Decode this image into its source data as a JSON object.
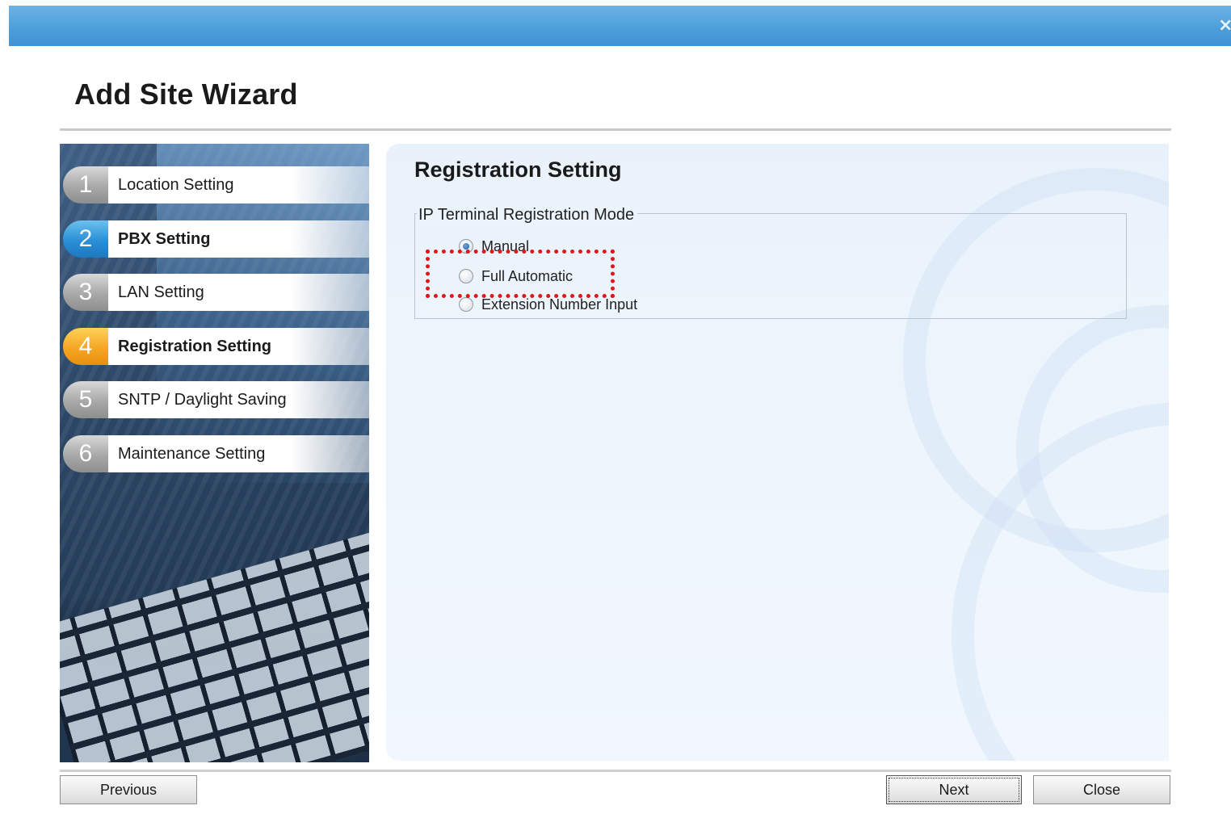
{
  "window": {
    "close_glyph": "×"
  },
  "wizard": {
    "title": "Add Site Wizard"
  },
  "steps": [
    {
      "number": "1",
      "label": "Location Setting",
      "state": "pending"
    },
    {
      "number": "2",
      "label": "PBX Setting",
      "state": "completed"
    },
    {
      "number": "3",
      "label": "LAN Setting",
      "state": "pending"
    },
    {
      "number": "4",
      "label": "Registration Setting",
      "state": "current"
    },
    {
      "number": "5",
      "label": "SNTP / Daylight Saving",
      "state": "pending"
    },
    {
      "number": "6",
      "label": "Maintenance Setting",
      "state": "pending"
    }
  ],
  "section": {
    "title": "Registration Setting",
    "group_label": "IP Terminal Registration Mode",
    "options": [
      {
        "label": "Manual",
        "selected": true
      },
      {
        "label": "Full Automatic",
        "selected": false,
        "highlighted": true
      },
      {
        "label": "Extension Number Input",
        "selected": false
      }
    ]
  },
  "buttons": {
    "previous": "Previous",
    "next": "Next",
    "close": "Close"
  },
  "colors": {
    "title_bar": "#4d9fdb",
    "step_completed": "#2a8fd6",
    "step_current": "#f5a623",
    "step_pending": "#a8a8a8",
    "highlight": "#e0161b"
  }
}
